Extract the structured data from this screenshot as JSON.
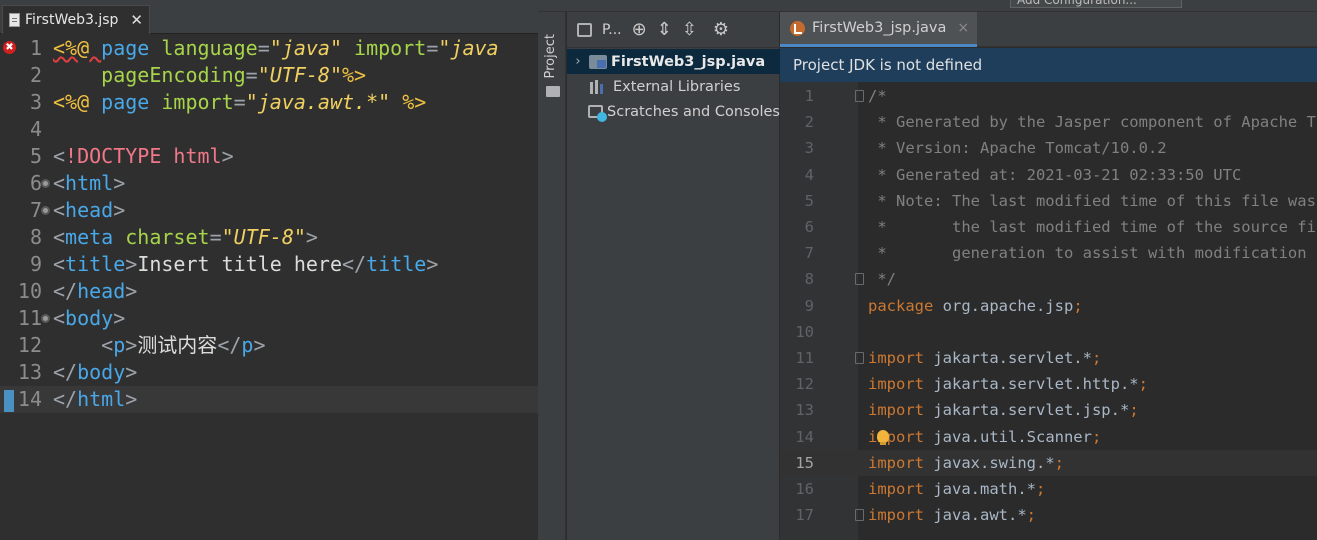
{
  "eclipse": {
    "tab_label": "FirstWeb3.jsp",
    "tab_close": "✕",
    "error_glyph": "✖",
    "lines": [
      {
        "n": "1",
        "parts": [
          [
            "dir",
            "<%@ "
          ],
          [
            "tag",
            "page "
          ],
          [
            "attr",
            "language"
          ],
          [
            "punct",
            "="
          ],
          [
            "str",
            "\"java\""
          ],
          [
            "attr",
            " import"
          ],
          [
            "punct",
            "="
          ],
          [
            "str",
            "\"java"
          ]
        ]
      },
      {
        "n": "2",
        "parts": [
          [
            "attr",
            "    pageEncoding"
          ],
          [
            "punct",
            "="
          ],
          [
            "str",
            "\"UTF-8\""
          ],
          [
            "dir",
            "%>"
          ]
        ]
      },
      {
        "n": "3",
        "parts": [
          [
            "dir",
            "<%@ "
          ],
          [
            "tag",
            "page "
          ],
          [
            "attr",
            "import"
          ],
          [
            "punct",
            "="
          ],
          [
            "str",
            "\"java.awt.*\""
          ],
          [
            "dir",
            " %>"
          ]
        ]
      },
      {
        "n": "4",
        "parts": []
      },
      {
        "n": "5",
        "parts": [
          [
            "punct",
            "<"
          ],
          [
            "doc",
            "!DOCTYPE"
          ],
          [
            "punct",
            " "
          ],
          [
            "doc",
            "html"
          ],
          [
            "punct",
            ">"
          ]
        ]
      },
      {
        "n": "6",
        "parts": [
          [
            "punct",
            "<"
          ],
          [
            "tag",
            "html"
          ],
          [
            "punct",
            ">"
          ]
        ]
      },
      {
        "n": "7",
        "parts": [
          [
            "punct",
            "<"
          ],
          [
            "tag",
            "head"
          ],
          [
            "punct",
            ">"
          ]
        ]
      },
      {
        "n": "8",
        "parts": [
          [
            "punct",
            "<"
          ],
          [
            "tag",
            "meta "
          ],
          [
            "attr",
            "charset"
          ],
          [
            "punct",
            "="
          ],
          [
            "str",
            "\"UTF-8\""
          ],
          [
            "punct",
            ">"
          ]
        ]
      },
      {
        "n": "9",
        "parts": [
          [
            "punct",
            "<"
          ],
          [
            "tag",
            "title"
          ],
          [
            "punct",
            ">"
          ],
          [
            "text",
            "Insert title here"
          ],
          [
            "punct",
            "</"
          ],
          [
            "tag",
            "title"
          ],
          [
            "punct",
            ">"
          ]
        ]
      },
      {
        "n": "10",
        "parts": [
          [
            "punct",
            "</"
          ],
          [
            "tag",
            "head"
          ],
          [
            "punct",
            ">"
          ]
        ]
      },
      {
        "n": "11",
        "parts": [
          [
            "punct",
            "<"
          ],
          [
            "tag",
            "body"
          ],
          [
            "punct",
            ">"
          ]
        ]
      },
      {
        "n": "12",
        "parts": [
          [
            "text",
            "    "
          ],
          [
            "punct",
            "<"
          ],
          [
            "tag",
            "p"
          ],
          [
            "punct",
            ">"
          ],
          [
            "text",
            "测试内容"
          ],
          [
            "punct",
            "</"
          ],
          [
            "tag",
            "p"
          ],
          [
            "punct",
            ">"
          ]
        ]
      },
      {
        "n": "13",
        "parts": [
          [
            "punct",
            "</"
          ],
          [
            "tag",
            "body"
          ],
          [
            "punct",
            ">"
          ]
        ]
      },
      {
        "n": "14",
        "parts": [
          [
            "punct",
            "</"
          ],
          [
            "tag",
            "html"
          ],
          [
            "punct",
            ">"
          ]
        ]
      }
    ]
  },
  "idea": {
    "run_config": "Add Configuration...",
    "tool_window_label": "Project",
    "project_view_label": "P...",
    "project_tree": [
      {
        "label": "FirstWeb3_jsp.java",
        "expanded_arrow": "›",
        "bold": true
      },
      {
        "label": "External Libraries"
      },
      {
        "label": "Scratches and Consoles"
      }
    ],
    "editor_tab": "FirstWeb3_jsp.java",
    "editor_tab_close": "×",
    "banner": "Project JDK is not defined",
    "lines": [
      {
        "n": "1",
        "parts": [
          [
            "c",
            "/*"
          ]
        ]
      },
      {
        "n": "2",
        "parts": [
          [
            "c",
            " * Generated by the Jasper component of Apache Tomcat"
          ]
        ]
      },
      {
        "n": "3",
        "parts": [
          [
            "c",
            " * Version: Apache Tomcat/10.0.2"
          ]
        ]
      },
      {
        "n": "4",
        "parts": [
          [
            "c",
            " * Generated at: 2021-03-21 02:33:50 UTC"
          ]
        ]
      },
      {
        "n": "5",
        "parts": [
          [
            "c",
            " * Note: The last modified time of this file was set to"
          ]
        ]
      },
      {
        "n": "6",
        "parts": [
          [
            "c",
            " *       the last modified time of the source file after"
          ]
        ]
      },
      {
        "n": "7",
        "parts": [
          [
            "c",
            " *       generation to assist with modification tracking."
          ]
        ]
      },
      {
        "n": "8",
        "parts": [
          [
            "c",
            " */"
          ]
        ]
      },
      {
        "n": "9",
        "parts": [
          [
            "k",
            "package"
          ],
          [
            "p",
            " org.apache.jsp"
          ],
          [
            "k",
            ";"
          ]
        ]
      },
      {
        "n": "10",
        "parts": []
      },
      {
        "n": "11",
        "parts": [
          [
            "k",
            "import"
          ],
          [
            "p",
            " jakarta.servlet.*"
          ],
          [
            "k",
            ";"
          ]
        ]
      },
      {
        "n": "12",
        "parts": [
          [
            "k",
            "import"
          ],
          [
            "p",
            " jakarta.servlet.http.*"
          ],
          [
            "k",
            ";"
          ]
        ]
      },
      {
        "n": "13",
        "parts": [
          [
            "k",
            "import"
          ],
          [
            "p",
            " jakarta.servlet.jsp.*"
          ],
          [
            "k",
            ";"
          ]
        ]
      },
      {
        "n": "14",
        "parts": [
          [
            "k",
            "import"
          ],
          [
            "p",
            " java.util.Scanner"
          ],
          [
            "k",
            ";"
          ]
        ]
      },
      {
        "n": "15",
        "parts": [
          [
            "k",
            "import"
          ],
          [
            "p",
            " javax.swing.*"
          ],
          [
            "k",
            ";"
          ]
        ]
      },
      {
        "n": "16",
        "parts": [
          [
            "k",
            "import"
          ],
          [
            "p",
            " java.math.*"
          ],
          [
            "k",
            ";"
          ]
        ]
      },
      {
        "n": "17",
        "parts": [
          [
            "k",
            "import"
          ],
          [
            "p",
            " java.awt.*"
          ],
          [
            "k",
            ";"
          ]
        ]
      }
    ]
  },
  "colors": {
    "eclipse_bg": "#2f2f2f",
    "idea_bg": "#2b2b2b",
    "keyword": "#cc7832",
    "comment": "#808080",
    "jsp_tag": "#49a8e8",
    "jsp_attr": "#a6d44a",
    "jsp_string": "#f0d060",
    "banner_bg": "#1e3e5c"
  }
}
